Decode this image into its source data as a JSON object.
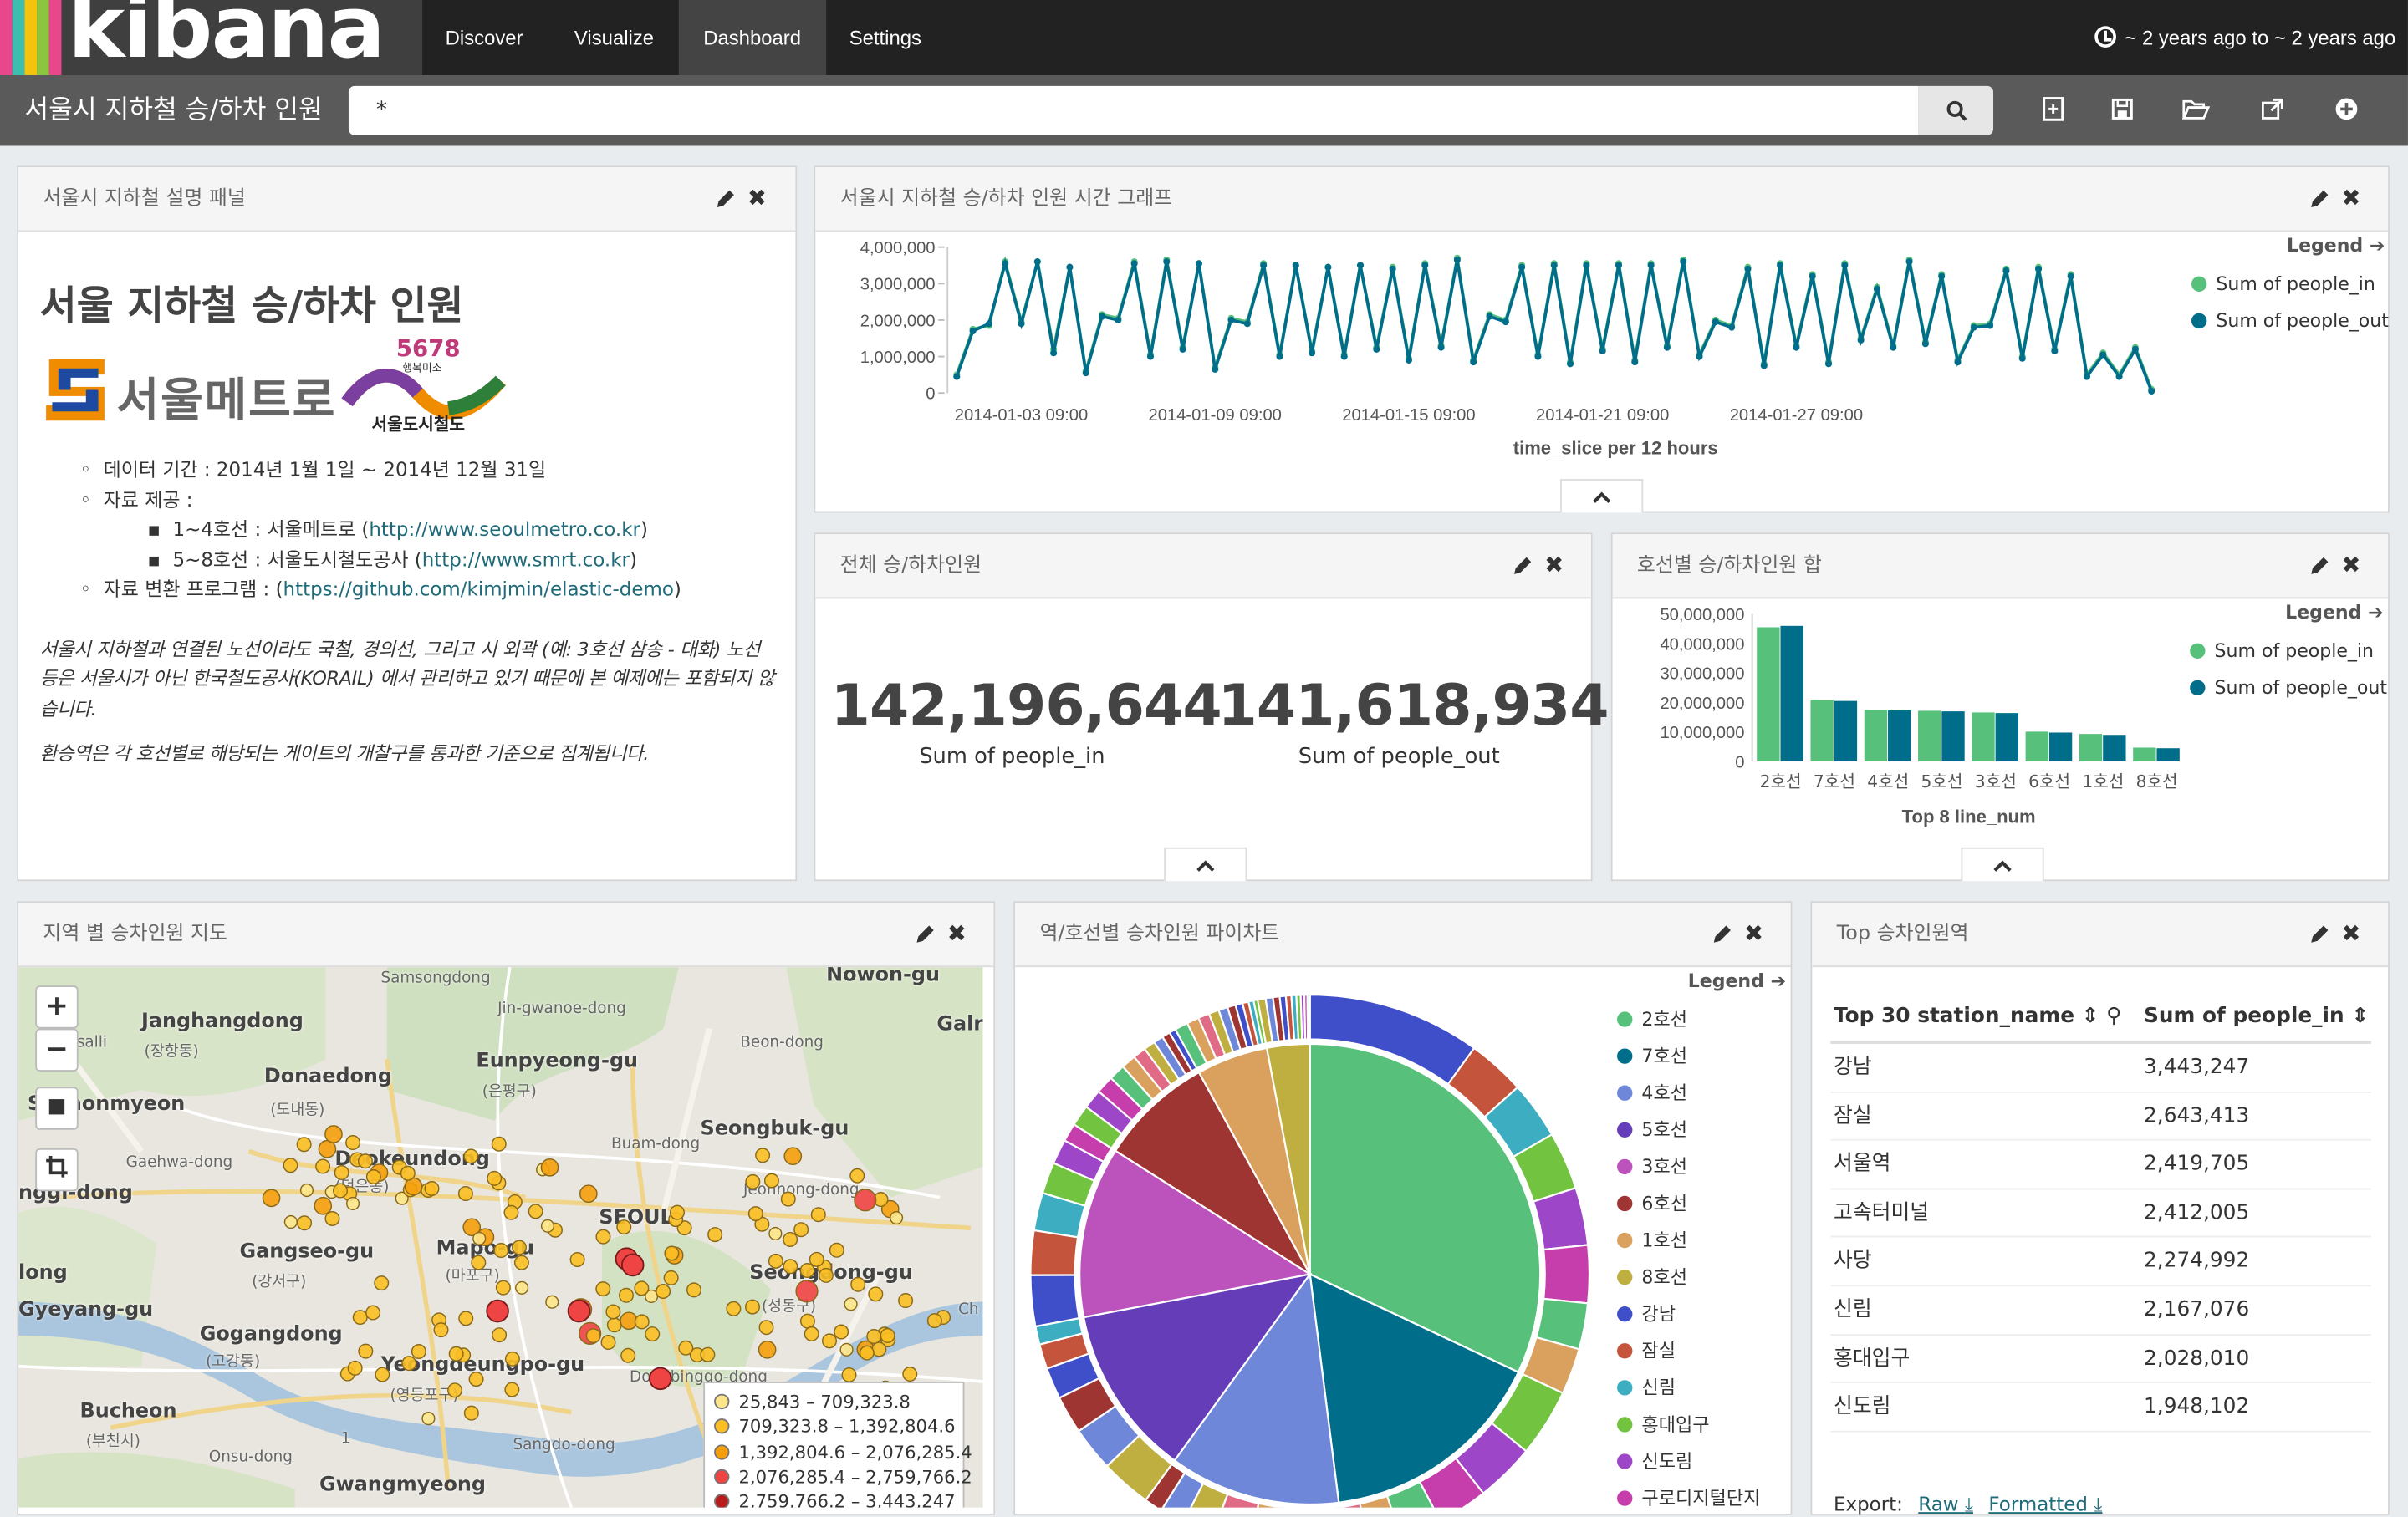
{
  "app": {
    "logo_text": "kibana",
    "nav": [
      "Discover",
      "Visualize",
      "Dashboard",
      "Settings"
    ],
    "active_nav": "Dashboard",
    "time_range": "~ 2 years ago to ~ 2 years ago"
  },
  "toolbar": {
    "dashboard_title": "서울시 지하철 승/하차 인원",
    "query": "*",
    "icons": [
      "new-dashboard-icon",
      "save-icon",
      "open-icon",
      "share-icon",
      "add-visualization-icon"
    ]
  },
  "panels": {
    "markdown": {
      "title": "서울시 지하철 설명 패널",
      "heading": "서울 지하철 승/하차 인원",
      "logo1_text": "서울메트로",
      "logo2_num": "5678",
      "logo2_sub": "행복미소",
      "logo2_text": "서울도시철도",
      "period": "데이터 기간 : 2014년 1월 1일 ~ 2014년 12월 31일",
      "source_label": "자료 제공 :",
      "source1_prefix": "1~4호선 : 서울메트로 (",
      "source1_link": "http://www.seoulmetro.co.kr",
      "source1_suffix": ")",
      "source2_prefix": "5~8호선 : 서울도시철도공사 (",
      "source2_link": "http://www.smrt.co.kr",
      "source2_suffix": ")",
      "program_prefix": "자료 변환 프로그램 : (",
      "program_link": "https://github.com/kimjmin/elastic-demo",
      "program_suffix": ")",
      "note1": "서울시 지하철과 연결된 노선이라도 국철, 경의선, 그리고 시 외곽 (예: 3호선 삼송 - 대화) 노선 등은 서울시가 아닌 한국철도공사(KORAIL) 에서 관리하고 있기 때문에 본 예제에는 포함되지 않습니다.",
      "note2": "환승역은 각 호선별로 해당되는 게이트의 개찰구를 통과한 기준으로 집계됩니다."
    },
    "timeline": {
      "title": "서울시 지하철 승/하차 인원 시간 그래프",
      "legend_title": "Legend",
      "series": [
        "Sum of people_in",
        "Sum of people_out"
      ]
    },
    "metric": {
      "title": "전체 승/하차인원",
      "value_in": "142,196,644",
      "label_in": "Sum of people_in",
      "value_out": "141,618,934",
      "label_out": "Sum of people_out"
    },
    "bar": {
      "title": "호선별 승/하차인원 합",
      "legend_title": "Legend",
      "series": [
        "Sum of people_in",
        "Sum of people_out"
      ]
    },
    "map": {
      "title": "지역 별 승차인원 지도",
      "zoom_in": "+",
      "zoom_out": "−",
      "labels": [
        {
          "text": "Janghangdong",
          "cls": ""
        },
        {
          "text": "(장항동)",
          "cls": "small"
        },
        {
          "text": "Sochonmyeon",
          "cls": ""
        },
        {
          "text": "Donaedong",
          "cls": ""
        },
        {
          "text": "(도내동)",
          "cls": "small"
        },
        {
          "text": "Eunpyeong-gu",
          "cls": ""
        },
        {
          "text": "(은평구)",
          "cls": "small"
        },
        {
          "text": "Deokeundong",
          "cls": ""
        },
        {
          "text": "(덕은동)",
          "cls": "small"
        },
        {
          "text": "Seongbuk-gu",
          "cls": ""
        },
        {
          "text": "SEOUL",
          "cls": ""
        },
        {
          "text": "Gangseo-gu",
          "cls": ""
        },
        {
          "text": "(강서구)",
          "cls": "small"
        },
        {
          "text": "Mapo-gu",
          "cls": ""
        },
        {
          "text": "(마포구)",
          "cls": "small"
        },
        {
          "text": "Seongdong-gu",
          "cls": ""
        },
        {
          "text": "(성동구)",
          "cls": "small"
        },
        {
          "text": "Gyeyang-gu",
          "cls": ""
        },
        {
          "text": "Gogangdong",
          "cls": ""
        },
        {
          "text": "(고강동)",
          "cls": "small"
        },
        {
          "text": "Yeongdeungpo-gu",
          "cls": ""
        },
        {
          "text": "(영등포구)",
          "cls": "small"
        },
        {
          "text": "Bucheon",
          "cls": ""
        },
        {
          "text": "(부천시)",
          "cls": "small"
        },
        {
          "text": "Gwangmyeong",
          "cls": ""
        },
        {
          "text": "Samsongdong",
          "cls": "small"
        },
        {
          "text": "Nowon-gu",
          "cls": ""
        },
        {
          "text": "Jin-gwanoe-dong",
          "cls": "small"
        },
        {
          "text": "Beon-dong",
          "cls": "small"
        },
        {
          "text": "Buam-dong",
          "cls": "small"
        },
        {
          "text": "Jeonnong-dong",
          "cls": "small"
        },
        {
          "text": "Dongbinggo-dong",
          "cls": "small"
        },
        {
          "text": "Sangdo-dong",
          "cls": "small"
        },
        {
          "text": "Onsu-dong",
          "cls": "small"
        },
        {
          "text": "Gaehwa-dong",
          "cls": "small"
        },
        {
          "text": "Galr",
          "cls": ""
        },
        {
          "text": "Ch",
          "cls": "small"
        },
        {
          "text": "salli",
          "cls": "small"
        },
        {
          "text": "nggi-dong",
          "cls": ""
        },
        {
          "text": "long",
          "cls": ""
        },
        {
          "text": "1",
          "cls": "small"
        }
      ],
      "legend": [
        {
          "range": "25,843 – 709,323.8",
          "color": "#fde68a"
        },
        {
          "range": "709,323.8 – 1,392,804.6",
          "color": "#fbbf24"
        },
        {
          "range": "1,392,804.6 – 2,076,285.4",
          "color": "#f59e0b"
        },
        {
          "range": "2,076,285.4 – 2,759,766.2",
          "color": "#ef4444"
        },
        {
          "range": "2,759,766.2 – 3,443,247",
          "color": "#b91c1c"
        }
      ]
    },
    "pie": {
      "title": "역/호선별 승차인원 파이차트",
      "legend_title": "Legend"
    },
    "table": {
      "title": "Top 승차인원역",
      "col1": "Top 30 station_name",
      "col2": "Sum of people_in",
      "rows": [
        [
          "강남",
          "3,443,247"
        ],
        [
          "잠실",
          "2,643,413"
        ],
        [
          "서울역",
          "2,419,705"
        ],
        [
          "고속터미널",
          "2,412,005"
        ],
        [
          "사당",
          "2,274,992"
        ],
        [
          "신림",
          "2,167,076"
        ],
        [
          "홍대입구",
          "2,028,010"
        ],
        [
          "신도림",
          "1,948,102"
        ]
      ],
      "export_label": "Export:",
      "export_raw": "Raw",
      "export_formatted": "Formatted"
    }
  },
  "colors": {
    "green": "#57c17b",
    "teal": "#006e8a",
    "purple": "#6f87d8"
  },
  "chart_data": [
    {
      "type": "line",
      "title": "",
      "xlabel": "time_slice per 12 hours",
      "ylabel": "",
      "ylim": [
        0,
        4000000
      ],
      "y_ticks": [
        "0",
        "1,000,000",
        "2,000,000",
        "3,000,000",
        "4,000,000"
      ],
      "x_ticks": [
        "2014-01-03 09:00",
        "2014-01-09 09:00",
        "2014-01-15 09:00",
        "2014-01-21 09:00",
        "2014-01-27 09:00"
      ],
      "x_start": "2014-01-01 09:00",
      "x_step_hours": 12,
      "series": [
        {
          "name": "Sum of people_in",
          "color": "#57c17b",
          "values": [
            500000,
            1750000,
            1850000,
            3600000,
            1950000,
            3600000,
            1200000,
            3450000,
            600000,
            2150000,
            2050000,
            3600000,
            1050000,
            3650000,
            1250000,
            3550000,
            700000,
            2050000,
            1950000,
            3550000,
            1050000,
            3500000,
            1150000,
            3450000,
            1050000,
            3500000,
            1250000,
            3450000,
            950000,
            3550000,
            1300000,
            3700000,
            900000,
            2150000,
            2000000,
            3500000,
            1050000,
            3550000,
            850000,
            3550000,
            1200000,
            3550000,
            900000,
            3550000,
            1300000,
            3650000,
            1050000,
            2000000,
            1850000,
            3450000,
            800000,
            3550000,
            1300000,
            3250000,
            850000,
            3550000,
            1500000,
            2900000,
            1300000,
            3650000,
            1400000,
            3250000,
            900000,
            1850000,
            1900000,
            3400000,
            1000000,
            3450000,
            1200000,
            3250000,
            500000,
            1100000,
            500000,
            1250000,
            100000
          ]
        },
        {
          "name": "Sum of people_out",
          "color": "#006e8a",
          "values": [
            450000,
            1700000,
            1900000,
            3550000,
            1900000,
            3600000,
            1100000,
            3450000,
            550000,
            2100000,
            2000000,
            3550000,
            1000000,
            3600000,
            1200000,
            3550000,
            650000,
            2000000,
            1900000,
            3500000,
            1000000,
            3500000,
            1100000,
            3450000,
            1000000,
            3500000,
            1200000,
            3400000,
            900000,
            3500000,
            1250000,
            3650000,
            850000,
            2100000,
            1950000,
            3450000,
            1000000,
            3500000,
            800000,
            3500000,
            1150000,
            3500000,
            850000,
            3500000,
            1250000,
            3600000,
            1000000,
            1950000,
            1800000,
            3400000,
            750000,
            3500000,
            1250000,
            3200000,
            800000,
            3500000,
            1450000,
            2850000,
            1250000,
            3600000,
            1350000,
            3200000,
            850000,
            1800000,
            1850000,
            3350000,
            950000,
            3400000,
            1150000,
            3200000,
            450000,
            1050000,
            450000,
            1200000,
            50000
          ]
        }
      ]
    },
    {
      "type": "bar",
      "title": "",
      "xlabel": "Top 8 line_num",
      "ylabel": "",
      "ylim": [
        0,
        50000000
      ],
      "y_ticks": [
        "0",
        "10,000,000",
        "20,000,000",
        "30,000,000",
        "40,000,000",
        "50,000,000"
      ],
      "categories": [
        "2호선",
        "7호선",
        "4호선",
        "5호선",
        "3호선",
        "6호선",
        "1호선",
        "8호선"
      ],
      "series": [
        {
          "name": "Sum of people_in",
          "color": "#57c17b",
          "values": [
            45500000,
            21000000,
            17500000,
            17200000,
            16600000,
            10100000,
            9300000,
            4700000
          ]
        },
        {
          "name": "Sum of people_out",
          "color": "#006e8a",
          "values": [
            46000000,
            20500000,
            17300000,
            17000000,
            16400000,
            9800000,
            9000000,
            4500000
          ]
        }
      ]
    },
    {
      "type": "pie",
      "title": "",
      "inner": {
        "labels": [
          "2호선",
          "7호선",
          "4호선",
          "5호선",
          "3호선",
          "6호선",
          "1호선",
          "8호선"
        ],
        "values": [
          32,
          16,
          12,
          12,
          12,
          8,
          5,
          3
        ],
        "colors": [
          "#57c17b",
          "#006e8a",
          "#6f87d8",
          "#663db8",
          "#bc52bc",
          "#9e3533",
          "#daa05d",
          "#bfaf40"
        ]
      },
      "legend": [
        {
          "label": "2호선",
          "color": "#57c17b"
        },
        {
          "label": "7호선",
          "color": "#006e8a"
        },
        {
          "label": "4호선",
          "color": "#6f87d8"
        },
        {
          "label": "5호선",
          "color": "#663db8"
        },
        {
          "label": "3호선",
          "color": "#bc52bc"
        },
        {
          "label": "6호선",
          "color": "#9e3533"
        },
        {
          "label": "1호선",
          "color": "#daa05d"
        },
        {
          "label": "8호선",
          "color": "#bfaf40"
        },
        {
          "label": "강남",
          "color": "#3f4ec9"
        },
        {
          "label": "잠실",
          "color": "#c4543c"
        },
        {
          "label": "신림",
          "color": "#3daec2"
        },
        {
          "label": "홍대입구",
          "color": "#72c33f"
        },
        {
          "label": "신도림",
          "color": "#9e46c8"
        },
        {
          "label": "구로디지털단지",
          "color": "#c63dac"
        }
      ]
    }
  ]
}
